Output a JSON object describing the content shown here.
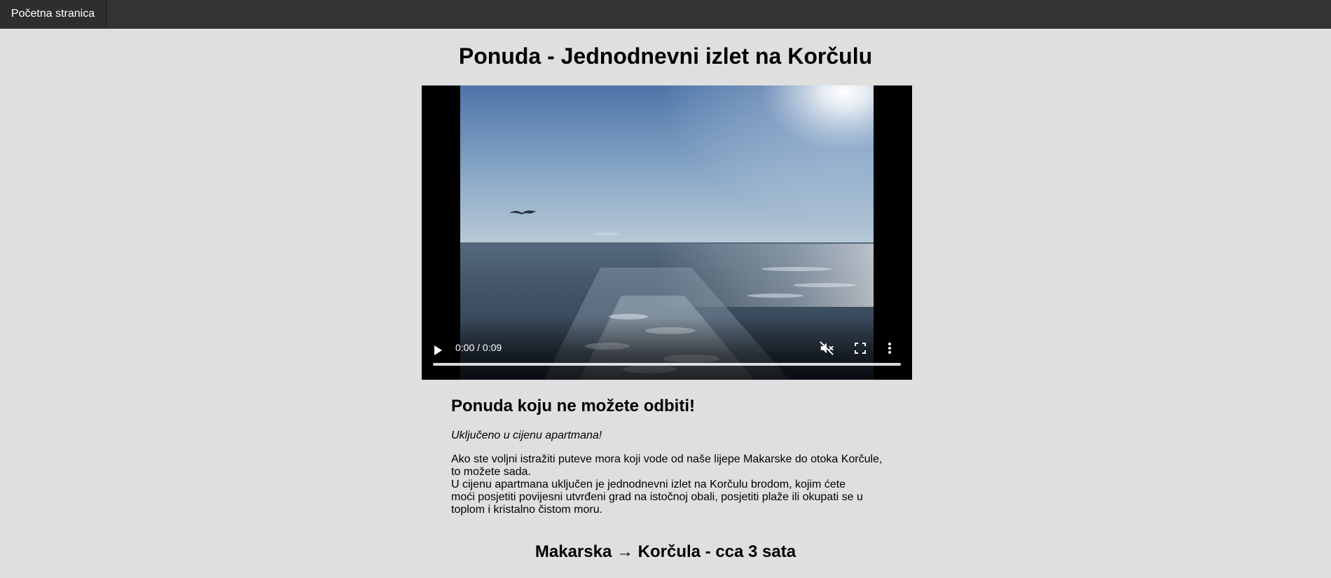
{
  "nav": {
    "home_label": "Početna stranica"
  },
  "page": {
    "title": "Ponuda - Jednodnevni izlet na Korčulu"
  },
  "video": {
    "current_time": "0:00",
    "duration": "0:09",
    "time_text": "0:00 / 0:09",
    "progress": 0,
    "muted": true,
    "icons": [
      "play-icon",
      "volume-muted-icon",
      "fullscreen-icon",
      "more-options-icon"
    ]
  },
  "offer": {
    "heading": "Ponuda koju ne možete odbiti!",
    "included_note": "Uključeno u cijenu apartmana!",
    "paragraph_lines": [
      "Ako ste voljni istražiti puteve mora koji vode od naše lijepe Makarske do otoka Korčule,",
      "to možete sada.",
      "U cijenu apartmana uključen je jednodnevni izlet na Korčulu brodom, kojim ćete",
      "moći posjetiti povijesni utvrđeni grad na istočnoj obali, posjetiti plaže ili okupati se u",
      "toplom i kristalno čistom moru."
    ]
  },
  "route": {
    "heading": "Makarska → Korčula - cca 3 sata"
  },
  "colors": {
    "background": "#dfdfdf",
    "nav_bar": "#333333",
    "nav_text": "#ffffff"
  }
}
